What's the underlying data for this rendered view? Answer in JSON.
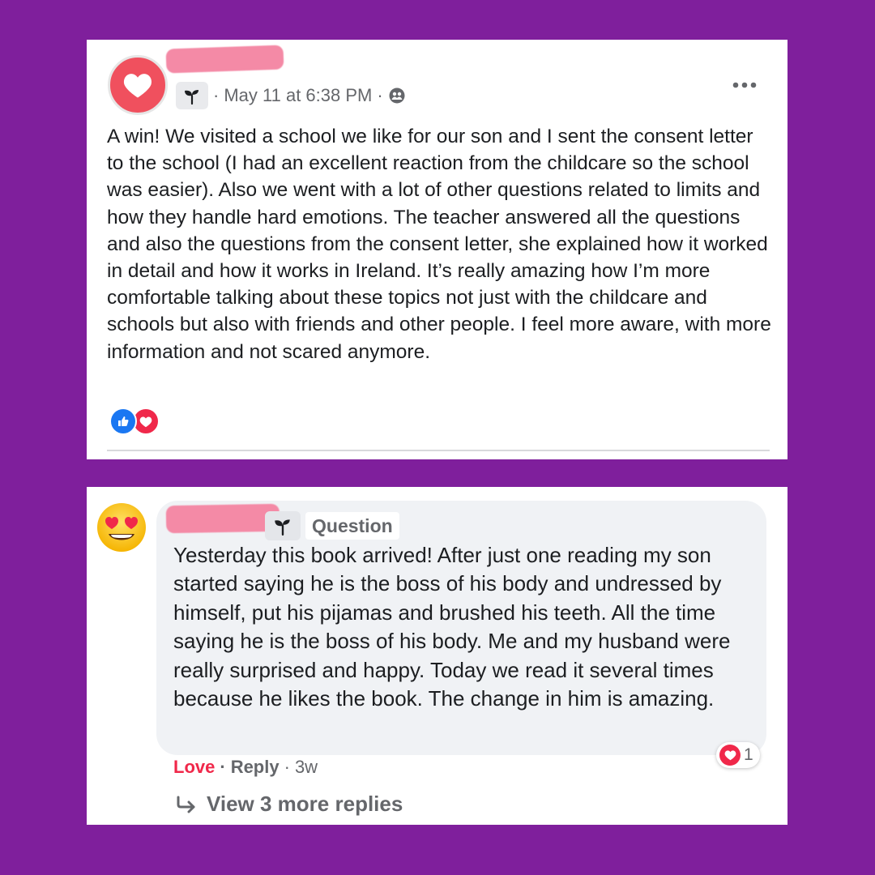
{
  "post": {
    "timestamp": "May 11 at 6:38 PM",
    "separator_1": "·",
    "separator_2": "·",
    "more_icon": "more-horizontal-icon",
    "body": "A win! We visited a school we like for our son and I sent the consent letter to the school (I had an excellent reaction from the childcare so the school was easier). Also we went with a lot of other questions related to limits and how they handle hard emotions. The teacher answered all the questions and also the questions from the consent letter, she explained how it worked in detail and how it works in Ireland. It’s really amazing how I’m more comfortable talking about these topics not just with the childcare and schools but also with friends and other people. I feel more aware, with more information and not scared anymore.",
    "reactions": [
      "like-icon",
      "love-icon"
    ]
  },
  "comment": {
    "tag": "Question",
    "body": "Yesterday this book arrived! After just one reading my son started saying he is the boss of his body and undressed by himself, put his pijamas and brushed his teeth. All the time saying he is the boss of his body. Me and my husband were really surprised and happy. Today we read it several times because he likes the book. The change in him is amazing.",
    "reaction_count": "1",
    "actions": {
      "love": "Love",
      "sep_1": "·",
      "reply": "Reply",
      "sep_2": "·",
      "time": "3w"
    },
    "view_replies": "View 3 more replies"
  },
  "colors": {
    "background": "#7f1f9c",
    "love": "#f0284a",
    "like": "#1a77f2",
    "redaction": "#f48aa6"
  }
}
